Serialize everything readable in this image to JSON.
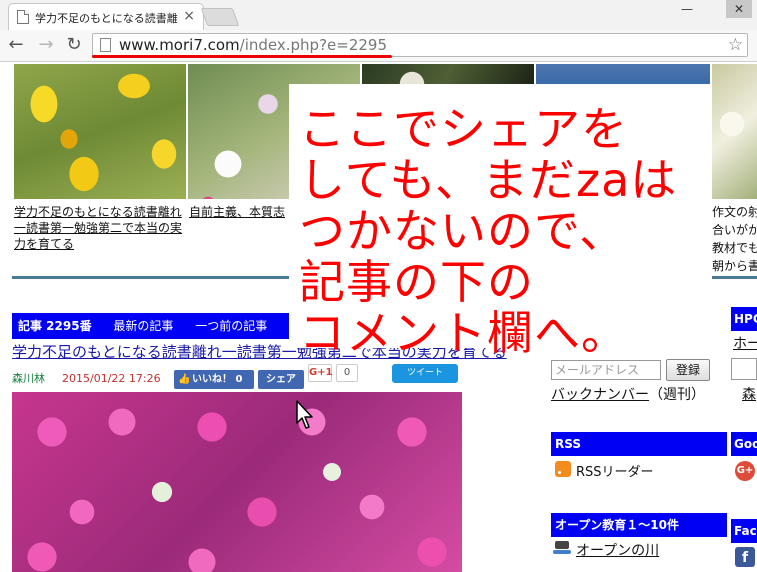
{
  "browser": {
    "tab_title": "学力不足のもとになる読書離",
    "tab_close": "×",
    "url_host": "www.mori7.com",
    "url_path": "/index.php?e=2295",
    "back": "←",
    "forward": "→",
    "reload": "↻",
    "star": "☆",
    "win_minimize": "—",
    "win_close": "✕"
  },
  "thumbnails": [
    {
      "caption": "学力不足のもとになる読書離れ一読書第一勉強第二で本当の実力を育てる"
    },
    {
      "caption": "自前主義、本質志神"
    }
  ],
  "article": {
    "number": "記事 2295番",
    "latest": "最新の記事",
    "previous": "一つ前の記事",
    "next_fragment": "一",
    "title": "学力不足のもとになる読書離れ一読書第一勉強第二で本当の実力を育てる",
    "author": "森川林",
    "date": "2015/01/22 17:26",
    "like_label": "いいね！ 0",
    "share_label": "シェア",
    "gplus_label": "G+1",
    "gplus_count": "0",
    "tweet_label": "ツイート"
  },
  "sidebar": {
    "email_placeholder": "メールアドレス",
    "register_button": "登録",
    "backnumber_link": "バックナンバー",
    "backnumber_suffix": "（週刊）",
    "rss_heading": "RSS",
    "rss_reader": "RSSリーダー",
    "open_heading": "オープン教育１〜10件",
    "open_river": "オープンの川"
  },
  "far_right": {
    "line1": "作文の射",
    "line2": "合いがか",
    "line3": "教材でも",
    "line4": "朝から書",
    "hp_heading": "HPC",
    "hp_link": "ホー",
    "mori_link": "森",
    "google_heading": "Goo",
    "google_icon": "G+",
    "facebook_heading": "Face",
    "facebook_icon": "f"
  },
  "annotation": {
    "lines": [
      "ここでシェアを",
      "しても、まだzaは",
      "つかないので、",
      "記事の下の",
      "コメント欄へ。"
    ],
    "color": "#ff0000"
  }
}
